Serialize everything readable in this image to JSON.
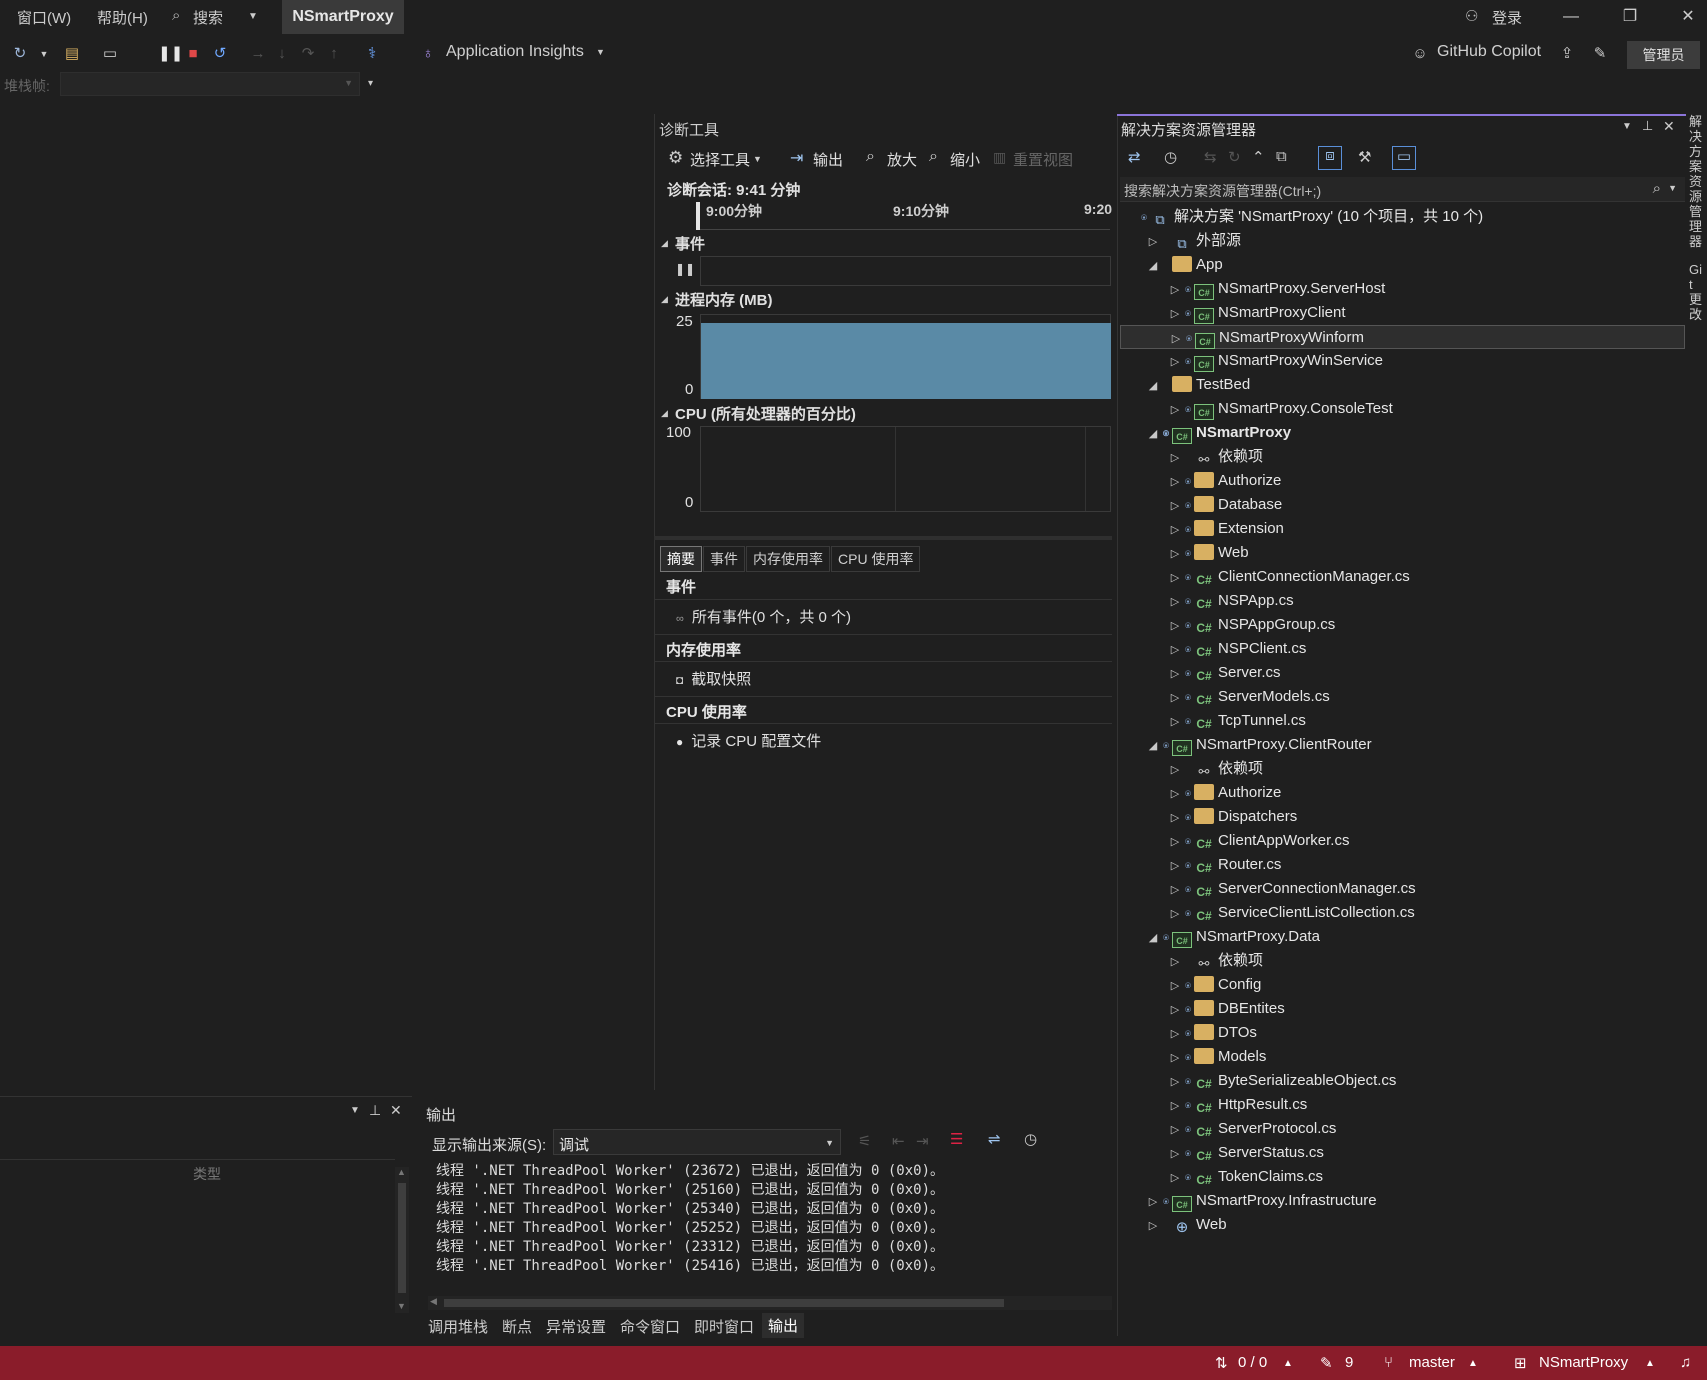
{
  "menu": {
    "window": "窗口(W)",
    "help": "帮助(H)",
    "search": "搜索",
    "project_title": "NSmartProxy"
  },
  "title_right": {
    "login": "登录",
    "minimize": "—",
    "restore": "❐",
    "close": "✕"
  },
  "toolbar": {
    "app_insights": "Application Insights",
    "copilot": "GitHub Copilot",
    "admin": "管理员"
  },
  "stack": {
    "label": "堆栈帧:"
  },
  "diag": {
    "title": "诊断工具",
    "select_tools": "选择工具",
    "output": "输出",
    "zoom_in": "放大",
    "zoom_out": "缩小",
    "reset_view": "重置视图",
    "session": "诊断会话: 9:41 分钟",
    "ticks": [
      "9:00分钟",
      "9:10分钟",
      "9:20"
    ],
    "events_title": "事件",
    "memory_title": "进程内存 (MB)",
    "memory_max": "25",
    "memory_min": "0",
    "cpu_title": "CPU (所有处理器的百分比)",
    "cpu_max": "100",
    "cpu_min": "0",
    "tabs": [
      "摘要",
      "事件",
      "内存使用率",
      "CPU 使用率"
    ],
    "sum_events": "事件",
    "sum_all_events": "所有事件(0 个，共 0 个)",
    "sum_memory": "内存使用率",
    "sum_snapshot": "截取快照",
    "sum_cpu": "CPU 使用率",
    "sum_record": "记录 CPU 配置文件"
  },
  "solution": {
    "title": "解决方案资源管理器",
    "search_placeholder": "搜索解决方案资源管理器(Ctrl+;)",
    "items": [
      {
        "label": "解决方案 'NSmartProxy' (10 个项目，共 10 个)",
        "icon": "solution-icon",
        "indent": 0,
        "arrow": "",
        "lock": true
      },
      {
        "label": "外部源",
        "icon": "external-icon",
        "indent": 1,
        "arrow": "▷",
        "lock": false
      },
      {
        "label": "App",
        "icon": "folder-icon",
        "indent": 1,
        "arrow": "◢",
        "lock": false
      },
      {
        "label": "NSmartProxy.ServerHost",
        "icon": "csproj-icon",
        "indent": 2,
        "arrow": "▷",
        "lock": true
      },
      {
        "label": "NSmartProxyClient",
        "icon": "csproj-icon",
        "indent": 2,
        "arrow": "▷",
        "lock": true
      },
      {
        "label": "NSmartProxyWinform",
        "icon": "csproj-icon",
        "indent": 2,
        "arrow": "▷",
        "lock": true,
        "selected": true
      },
      {
        "label": "NSmartProxyWinService",
        "icon": "csproj-icon",
        "indent": 2,
        "arrow": "▷",
        "lock": true
      },
      {
        "label": "TestBed",
        "icon": "folder-icon",
        "indent": 1,
        "arrow": "◢",
        "lock": false
      },
      {
        "label": "NSmartProxy.ConsoleTest",
        "icon": "csproj-icon",
        "indent": 2,
        "arrow": "▷",
        "lock": true
      },
      {
        "label": "NSmartProxy",
        "icon": "csproj-icon",
        "indent": 1,
        "arrow": "◢",
        "lock": true,
        "bold": true
      },
      {
        "label": "依赖项",
        "icon": "dependency-icon",
        "indent": 2,
        "arrow": "▷",
        "lock": false
      },
      {
        "label": "Authorize",
        "icon": "folder-icon",
        "indent": 2,
        "arrow": "▷",
        "lock": true
      },
      {
        "label": "Database",
        "icon": "folder-icon",
        "indent": 2,
        "arrow": "▷",
        "lock": true
      },
      {
        "label": "Extension",
        "icon": "folder-icon",
        "indent": 2,
        "arrow": "▷",
        "lock": true
      },
      {
        "label": "Web",
        "icon": "folder-icon",
        "indent": 2,
        "arrow": "▷",
        "lock": true
      },
      {
        "label": "ClientConnectionManager.cs",
        "icon": "csharp-icon",
        "indent": 2,
        "arrow": "▷",
        "lock": true
      },
      {
        "label": "NSPApp.cs",
        "icon": "csharp-icon",
        "indent": 2,
        "arrow": "▷",
        "lock": true
      },
      {
        "label": "NSPAppGroup.cs",
        "icon": "csharp-icon",
        "indent": 2,
        "arrow": "▷",
        "lock": true
      },
      {
        "label": "NSPClient.cs",
        "icon": "csharp-icon",
        "indent": 2,
        "arrow": "▷",
        "lock": true
      },
      {
        "label": "Server.cs",
        "icon": "csharp-icon",
        "indent": 2,
        "arrow": "▷",
        "lock": true
      },
      {
        "label": "ServerModels.cs",
        "icon": "csharp-icon",
        "indent": 2,
        "arrow": "▷",
        "lock": true
      },
      {
        "label": "TcpTunnel.cs",
        "icon": "csharp-icon",
        "indent": 2,
        "arrow": "▷",
        "lock": true
      },
      {
        "label": "NSmartProxy.ClientRouter",
        "icon": "csproj-icon",
        "indent": 1,
        "arrow": "◢",
        "lock": true
      },
      {
        "label": "依赖项",
        "icon": "dependency-icon",
        "indent": 2,
        "arrow": "▷",
        "lock": false
      },
      {
        "label": "Authorize",
        "icon": "folder-icon",
        "indent": 2,
        "arrow": "▷",
        "lock": true
      },
      {
        "label": "Dispatchers",
        "icon": "folder-icon",
        "indent": 2,
        "arrow": "▷",
        "lock": true
      },
      {
        "label": "ClientAppWorker.cs",
        "icon": "csharp-icon",
        "indent": 2,
        "arrow": "▷",
        "lock": true
      },
      {
        "label": "Router.cs",
        "icon": "csharp-icon",
        "indent": 2,
        "arrow": "▷",
        "lock": true
      },
      {
        "label": "ServerConnectionManager.cs",
        "icon": "csharp-icon",
        "indent": 2,
        "arrow": "▷",
        "lock": true
      },
      {
        "label": "ServiceClientListCollection.cs",
        "icon": "csharp-icon",
        "indent": 2,
        "arrow": "▷",
        "lock": true
      },
      {
        "label": "NSmartProxy.Data",
        "icon": "csproj-icon",
        "indent": 1,
        "arrow": "◢",
        "lock": true
      },
      {
        "label": "依赖项",
        "icon": "dependency-icon",
        "indent": 2,
        "arrow": "▷",
        "lock": false
      },
      {
        "label": "Config",
        "icon": "folder-icon",
        "indent": 2,
        "arrow": "▷",
        "lock": true
      },
      {
        "label": "DBEntites",
        "icon": "folder-icon",
        "indent": 2,
        "arrow": "▷",
        "lock": true
      },
      {
        "label": "DTOs",
        "icon": "folder-icon",
        "indent": 2,
        "arrow": "▷",
        "lock": true
      },
      {
        "label": "Models",
        "icon": "folder-icon",
        "indent": 2,
        "arrow": "▷",
        "lock": true
      },
      {
        "label": "ByteSerializeableObject.cs",
        "icon": "csharp-icon",
        "indent": 2,
        "arrow": "▷",
        "lock": true
      },
      {
        "label": "HttpResult.cs",
        "icon": "csharp-icon",
        "indent": 2,
        "arrow": "▷",
        "lock": true
      },
      {
        "label": "ServerProtocol.cs",
        "icon": "csharp-icon",
        "indent": 2,
        "arrow": "▷",
        "lock": true
      },
      {
        "label": "ServerStatus.cs",
        "icon": "csharp-icon",
        "indent": 2,
        "arrow": "▷",
        "lock": true
      },
      {
        "label": "TokenClaims.cs",
        "icon": "csharp-icon",
        "indent": 2,
        "arrow": "▷",
        "lock": true
      },
      {
        "label": "NSmartProxy.Infrastructure",
        "icon": "csproj-icon",
        "indent": 1,
        "arrow": "▷",
        "lock": true
      },
      {
        "label": "Web",
        "icon": "globe-icon",
        "indent": 1,
        "arrow": "▷",
        "lock": false
      }
    ]
  },
  "rail": {
    "tab1": "解决方案资源管理器",
    "tab2": "Git 更改"
  },
  "bottom_left": {
    "column_type": "类型"
  },
  "output": {
    "title": "输出",
    "source_label": "显示输出来源(S):",
    "source_value": "调试",
    "lines": [
      "线程 '.NET ThreadPool Worker' (23672) 已退出，返回值为 0 (0x0)。",
      "线程 '.NET ThreadPool Worker' (25160) 已退出，返回值为 0 (0x0)。",
      "线程 '.NET ThreadPool Worker' (25340) 已退出，返回值为 0 (0x0)。",
      "线程 '.NET ThreadPool Worker' (25252) 已退出，返回值为 0 (0x0)。",
      "线程 '.NET ThreadPool Worker' (23312) 已退出，返回值为 0 (0x0)。",
      "线程 '.NET ThreadPool Worker' (25416) 已退出，返回值为 0 (0x0)。"
    ]
  },
  "bottom_tabs": [
    "调用堆栈",
    "断点",
    "异常设置",
    "命令窗口",
    "即时窗口",
    "输出"
  ],
  "status": {
    "sync": "0 / 0",
    "changes": "9",
    "branch": "master",
    "repo": "NSmartProxy"
  },
  "colors": {
    "status_bar": "#8a1c2a",
    "memory_fill": "#5a8aa6",
    "selection": "#2e2e2e"
  }
}
